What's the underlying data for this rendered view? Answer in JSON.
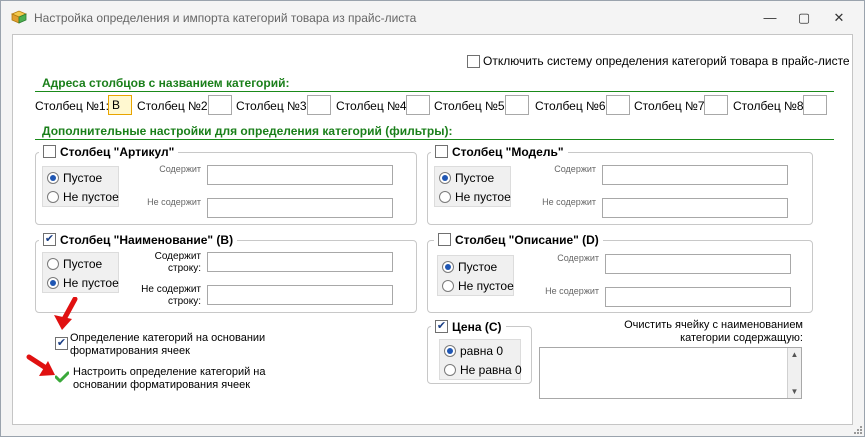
{
  "window": {
    "title": "Настройка определения и импорта категорий товара из прайс-листа",
    "minimize": "—",
    "maximize": "▢",
    "close": "✕"
  },
  "disable_system": {
    "label": "Отключить систему определения категорий товара в прайс-листе",
    "checked": false
  },
  "columns_section": {
    "header": "Адреса столбцов с названием категорий:",
    "fields": [
      {
        "label": "Столбец №1:",
        "value": "B"
      },
      {
        "label": "Столбец №2:",
        "value": ""
      },
      {
        "label": "Столбец №3:",
        "value": ""
      },
      {
        "label": "Столбец №4:",
        "value": ""
      },
      {
        "label": "Столбец №5:",
        "value": ""
      },
      {
        "label": "Столбец №6:",
        "value": ""
      },
      {
        "label": "Столбец №7:",
        "value": ""
      },
      {
        "label": "Столбец №8:",
        "value": ""
      }
    ]
  },
  "filters_section": {
    "header": "Дополнительные настройки для определения категорий (фильтры):"
  },
  "groups": {
    "article": {
      "title": "Столбец \"Артикул\"",
      "checked": false,
      "opt_empty": "Пустое",
      "opt_not_empty": "Не пустое",
      "selected": "empty",
      "contains": "Содержит",
      "not_contains": "Не содержит"
    },
    "model": {
      "title": "Столбец \"Модель\"",
      "checked": false,
      "opt_empty": "Пустое",
      "opt_not_empty": "Не пустое",
      "selected": "empty",
      "contains": "Содержит",
      "not_contains": "Не содержит"
    },
    "name": {
      "title": "Столбец \"Наименование\" (B)",
      "checked": true,
      "opt_empty": "Пустое",
      "opt_not_empty": "Не пустое",
      "selected": "not_empty",
      "contains": "Содержит строку:",
      "not_contains": "Не содержит строку:"
    },
    "description": {
      "title": "Столбец \"Описание\" (D)",
      "checked": false,
      "opt_empty": "Пустое",
      "opt_not_empty": "Не пустое",
      "selected": "empty",
      "contains": "Содержит",
      "not_contains": "Не содержит"
    },
    "price": {
      "title": "Цена (C)",
      "checked": true,
      "opt_equal0": "равна 0",
      "opt_notequal0": "Не равна 0",
      "selected": "equal0"
    }
  },
  "format_detection": {
    "label": "Определение категорий на основании форматирования ячеек",
    "checked": true
  },
  "configure_link": {
    "label": "Настроить определение категорий на основании форматирования ячеек",
    "icon": "green-checkmark-icon"
  },
  "clear_cell": {
    "label": "Очистить ячейку с наименованием категории содержащую:",
    "value": ""
  },
  "colors": {
    "section_green": "#1a7f1a",
    "arrow_red": "#e01010",
    "radio_blue": "#1f56b3"
  }
}
